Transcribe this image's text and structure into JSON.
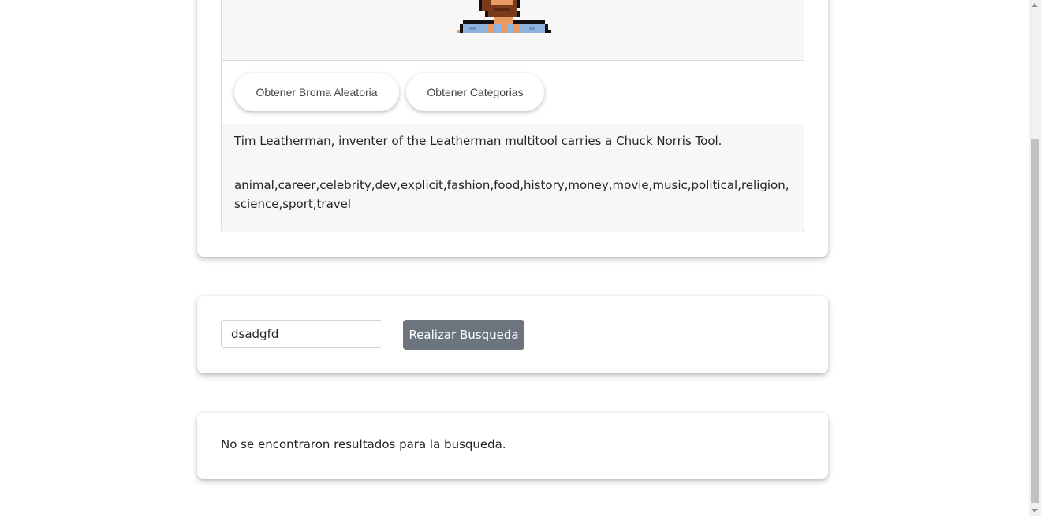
{
  "main_card": {
    "image_icon": "chuck-norris-pixel-avatar",
    "random_joke_button": "Obtener Broma Aleatoria",
    "categories_button": "Obtener Categorias",
    "joke_text": "Tim Leatherman, inventer of the Leatherman multitool carries a Chuck Norris Tool.",
    "categories_text": "animal,career,celebrity,dev,explicit,fashion,food,history,money,movie,music,political,religion,science,sport,travel"
  },
  "search_card": {
    "input_value": "dsadgfd",
    "search_button": "Realizar Busqueda"
  },
  "results_card": {
    "message": "No se encontraron resultados para la busqueda."
  },
  "colors": {
    "button_secondary": "#6c757d",
    "panel_background": "#f7f7f7",
    "text": "#212529"
  }
}
